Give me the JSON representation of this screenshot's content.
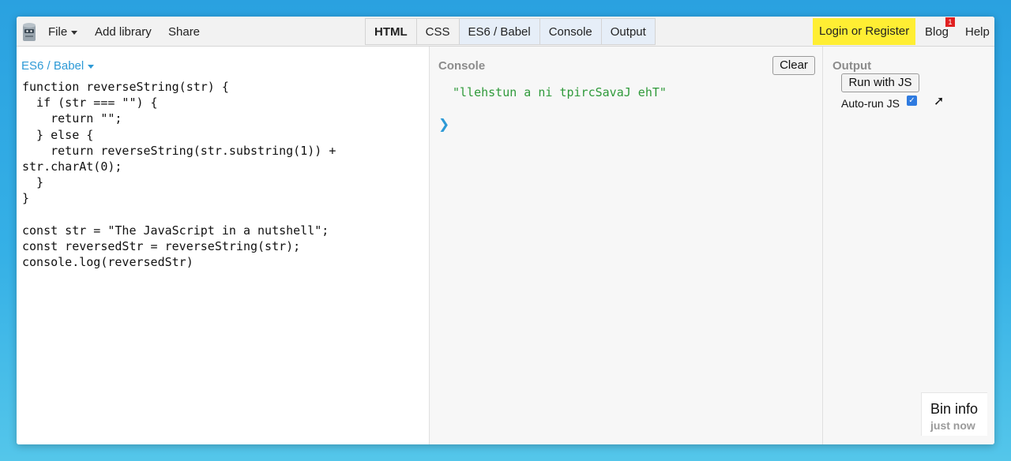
{
  "toolbar": {
    "logo_icon": "jsbin-logo-icon",
    "file_label": "File",
    "add_library_label": "Add library",
    "share_label": "Share",
    "tabs": [
      {
        "label": "HTML"
      },
      {
        "label": "CSS"
      },
      {
        "label": "ES6 / Babel"
      },
      {
        "label": "Console"
      },
      {
        "label": "Output"
      }
    ],
    "login_label": "Login or Register",
    "blog_label": "Blog",
    "blog_badge": "1",
    "help_label": "Help"
  },
  "editor": {
    "language_label": "ES6 / Babel",
    "code": "function reverseString(str) {\n  if (str === \"\") {\n    return \"\";\n  } else {\n    return reverseString(str.substring(1)) +\nstr.charAt(0);\n  }\n}\n\nconst str = \"The JavaScript in a nutshell\";\nconst reversedStr = reverseString(str);\nconsole.log(reversedStr)"
  },
  "console": {
    "title": "Console",
    "clear_label": "Clear",
    "output_line": "\"llehstun a ni tpircSavaJ ehT\"",
    "prompt_symbol": "❯"
  },
  "output": {
    "title": "Output",
    "run_label": "Run with JS",
    "autorun_label": "Auto-run JS",
    "autorun_checked": true
  },
  "bin_info": {
    "title": "Bin info",
    "subtitle": "just now"
  },
  "colors": {
    "accent_blue": "#2e9ad6",
    "login_yellow": "#ffee33",
    "console_green": "#2f9a3a",
    "badge_red": "#e02020"
  }
}
